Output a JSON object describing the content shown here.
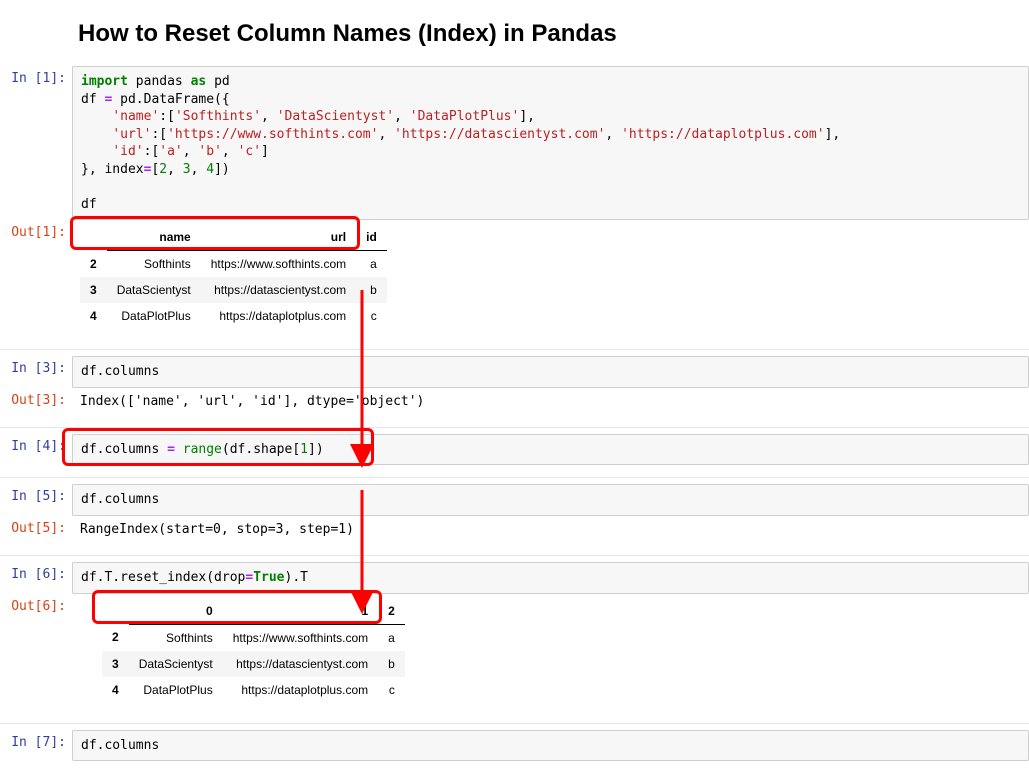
{
  "title": "How to Reset Column Names (Index) in Pandas",
  "cells": {
    "c1": {
      "in_prompt": "In [1]:",
      "out_prompt": "Out[1]:",
      "code": {
        "l1": {
          "kw1": "import",
          "nm1": " pandas ",
          "kw2": "as",
          "nm2": " pd"
        },
        "l2a": "df ",
        "l2op": "=",
        "l2b": " pd.DataFrame({",
        "l3a": "    ",
        "l3s1": "'name'",
        "l3b": ":[",
        "l3s2": "'Softhints'",
        "l3c": ", ",
        "l3s3": "'DataScientyst'",
        "l3d": ", ",
        "l3s4": "'DataPlotPlus'",
        "l3e": "],",
        "l4a": "    ",
        "l4s1": "'url'",
        "l4b": ":[",
        "l4s2": "'https://www.softhints.com'",
        "l4c": ", ",
        "l4s3": "'https://datascientyst.com'",
        "l4d": ", ",
        "l4s4": "'https://dataplotplus.com'",
        "l4e": "],",
        "l5a": "    ",
        "l5s1": "'id'",
        "l5b": ":[",
        "l5s2": "'a'",
        "l5c": ", ",
        "l5s3": "'b'",
        "l5d": ", ",
        "l5s4": "'c'",
        "l5e": "]",
        "l6a": "}, index",
        "l6op": "=",
        "l6b": "[",
        "l6n1": "2",
        "l6c": ", ",
        "l6n2": "3",
        "l6d": ", ",
        "l6n3": "4",
        "l6e": "])",
        "l8": "df"
      },
      "table": {
        "headers": [
          "",
          "name",
          "url",
          "id"
        ],
        "rows": [
          {
            "idx": "2",
            "c0": "Softhints",
            "c1": "https://www.softhints.com",
            "c2": "a"
          },
          {
            "idx": "3",
            "c0": "DataScientyst",
            "c1": "https://datascientyst.com",
            "c2": "b"
          },
          {
            "idx": "4",
            "c0": "DataPlotPlus",
            "c1": "https://dataplotplus.com",
            "c2": "c"
          }
        ]
      }
    },
    "c3": {
      "in_prompt": "In [3]:",
      "out_prompt": "Out[3]:",
      "code": "df.columns",
      "output": "Index(['name', 'url', 'id'], dtype='object')"
    },
    "c4": {
      "in_prompt": "In [4]:",
      "code_a": "df.columns ",
      "code_op": "=",
      "code_b": " ",
      "code_fn": "range",
      "code_c": "(df.shape[",
      "code_n": "1",
      "code_d": "])"
    },
    "c5": {
      "in_prompt": "In [5]:",
      "out_prompt": "Out[5]:",
      "code": "df.columns",
      "output": "RangeIndex(start=0, stop=3, step=1)"
    },
    "c6": {
      "in_prompt": "In [6]:",
      "out_prompt": "Out[6]:",
      "code_a": "df.T.reset_index(drop",
      "code_op": "=",
      "code_bool": "True",
      "code_b": ").T",
      "table": {
        "headers": [
          "",
          "0",
          "1",
          "2"
        ],
        "rows": [
          {
            "idx": "2",
            "c0": "Softhints",
            "c1": "https://www.softhints.com",
            "c2": "a"
          },
          {
            "idx": "3",
            "c0": "DataScientyst",
            "c1": "https://datascientyst.com",
            "c2": "b"
          },
          {
            "idx": "4",
            "c0": "DataPlotPlus",
            "c1": "https://dataplotplus.com",
            "c2": "c"
          }
        ]
      }
    },
    "c7": {
      "in_prompt": "In [7]:",
      "code": "df.columns"
    }
  }
}
